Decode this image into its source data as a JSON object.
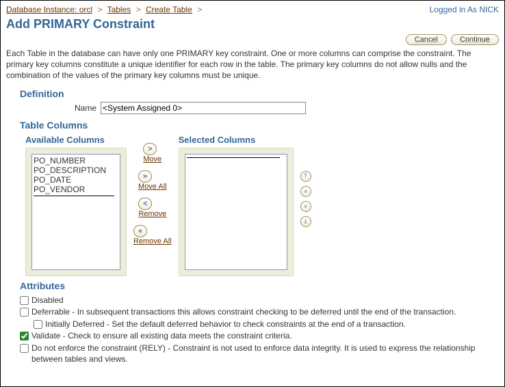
{
  "breadcrumb": {
    "instance_label": "Database Instance: orcl",
    "tables_label": "Tables",
    "create_label": "Create Table"
  },
  "logged_in": "Logged in As NICK",
  "page_title": "Add PRIMARY Constraint",
  "buttons": {
    "cancel": "Cancel",
    "continue": "Continue"
  },
  "intro_text": "Each Table in the database can have only one PRIMARY key constraint. One or more columns can comprise the constraint. The primary key columns constitute a unique identifier for each row in the table. The primary key columns do not allow nulls and the combination of the values of the primary key columns must be unique.",
  "sections": {
    "definition": "Definition",
    "table_columns": "Table Columns",
    "available": "Available Columns",
    "selected": "Selected Columns",
    "attributes": "Attributes"
  },
  "definition": {
    "name_label": "Name",
    "name_value": "<System Assigned 0>"
  },
  "available_columns": [
    "PO_NUMBER",
    "PO_DESCRIPTION",
    "PO_DATE",
    "PO_VENDOR"
  ],
  "shuttle": {
    "move": "Move",
    "move_all": "Move All",
    "remove": "Remove",
    "remove_all": "Remove All"
  },
  "attributes": {
    "disabled": "Disabled",
    "deferrable": "Deferrable - In subsequent transactions this allows constraint checking to be deferred until the end of the transaction.",
    "initially_deferred": "Initially Deferred - Set the default deferred behavior to check constraints at the end of a transaction.",
    "validate": "Validate - Check to ensure all existing data meets the constraint criteria.",
    "rely": "Do not enforce the constraint (RELY) - Constraint is not used to enforce data integrity. It is used to express the relationship between tables and views."
  }
}
